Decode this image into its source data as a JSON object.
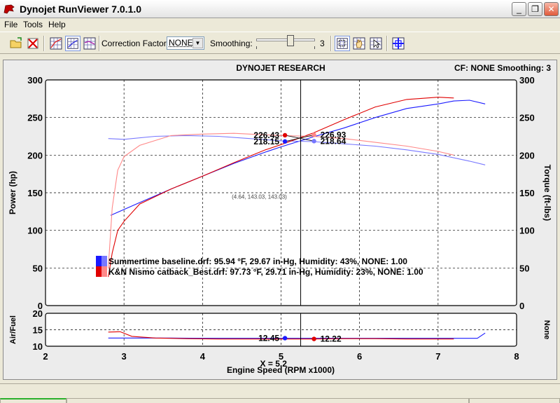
{
  "window": {
    "title": "Dynojet RunViewer 7.0.1.0",
    "minimize": "_",
    "restore": "❐",
    "close": "✕"
  },
  "menu": {
    "items": [
      "File",
      "Tools",
      "Help"
    ]
  },
  "toolbar": {
    "correction_label": "Correction Factor:",
    "correction_value": "NONE",
    "smoothing_label": "Smoothing:",
    "smoothing_value": "3"
  },
  "chart_data": {
    "type": "line",
    "title": "DYNOJET RESEARCH",
    "header_right": "CF: NONE  Smoothing: 3",
    "xlabel": "Engine Speed (RPM x1000)",
    "xlim": [
      2,
      8
    ],
    "x_ticks": [
      "2",
      "3",
      "4",
      "5",
      "6",
      "7",
      "8"
    ],
    "main": {
      "ylabel_left": "Power (hp)",
      "ylabel_right": "Torque (ft-lbs)",
      "ylim": [
        0,
        300
      ],
      "y_ticks": [
        "300",
        "250",
        "200",
        "150",
        "100",
        "50",
        "0"
      ],
      "grid": true,
      "series": [
        {
          "name": "Summertime baseline.drf",
          "kind": "power",
          "color": "#1a1aff",
          "x": [
            2.83,
            3.2,
            3.6,
            4.0,
            4.4,
            4.8,
            5.0,
            5.4,
            5.8,
            6.2,
            6.6,
            7.0,
            7.2,
            7.4,
            7.6
          ],
          "y": [
            120,
            137,
            155,
            172,
            189,
            204,
            211,
            224,
            236,
            250,
            262,
            268,
            272,
            273,
            268
          ]
        },
        {
          "name": "Summertime baseline.drf",
          "kind": "torque",
          "color": "#7777ff",
          "x": [
            2.8,
            3.0,
            3.4,
            3.8,
            4.2,
            4.6,
            5.0,
            5.4,
            5.8,
            6.2,
            6.6,
            7.0,
            7.4,
            7.6
          ],
          "y": [
            222,
            221,
            225,
            226,
            225,
            222,
            219,
            218,
            215,
            212,
            207,
            201,
            192,
            187
          ]
        },
        {
          "name": "K&N Nismo catback_Best.drf",
          "kind": "power",
          "color": "#e00000",
          "x": [
            2.8,
            2.85,
            2.92,
            3.0,
            3.2,
            3.6,
            4.0,
            4.4,
            4.8,
            5.0,
            5.4,
            5.8,
            6.2,
            6.6,
            7.0,
            7.2
          ],
          "y": [
            38,
            70,
            100,
            112,
            135,
            155,
            172,
            190,
            207,
            214,
            229,
            247,
            264,
            274,
            277,
            276
          ]
        },
        {
          "name": "K&N Nismo catback_Best.drf",
          "kind": "torque",
          "color": "#ff8888",
          "x": [
            2.8,
            2.85,
            2.92,
            3.0,
            3.2,
            3.6,
            4.0,
            4.4,
            4.8,
            5.0,
            5.4,
            5.8,
            6.2,
            6.6,
            7.0,
            7.2
          ],
          "y": [
            50,
            130,
            180,
            198,
            213,
            226,
            228,
            229,
            227,
            226,
            225,
            222,
            217,
            212,
            205,
            200
          ]
        }
      ],
      "markers": [
        {
          "x": 5.05,
          "y": 226.43,
          "label": "226.43",
          "color": "#e00000",
          "side": "left"
        },
        {
          "x": 5.05,
          "y": 218.15,
          "label": "218.15",
          "color": "#1a1aff",
          "side": "left"
        },
        {
          "x": 5.42,
          "y": 226.93,
          "label": "226.93",
          "color": "#ff8888",
          "side": "right"
        },
        {
          "x": 5.42,
          "y": 218.64,
          "label": "218.64",
          "color": "#7777ff",
          "side": "right"
        }
      ],
      "cursor_x": 5.25,
      "annotation": "(4.64, 143.03, 143.03)",
      "legend": [
        {
          "text": "Summertime baseline.drf: 95.94 °F, 29.67 in-Hg, Humidity: 43%, NONE: 1.00",
          "color": "#1a1aff"
        },
        {
          "text": "K&N Nismo catback_Best.drf: 97.73 °F, 29.71 in-Hg, Humidity: 23%, NONE: 1.00",
          "color": "#e00000"
        }
      ]
    },
    "afr": {
      "ylabel_left": "Air/Fuel",
      "ylabel_right": "None",
      "ylim": [
        10,
        20
      ],
      "y_ticks": [
        "20",
        "15",
        "10"
      ],
      "series": [
        {
          "name": "Summertime baseline.drf",
          "color": "#1a1aff",
          "x": [
            2.8,
            3.2,
            3.6,
            4.0,
            4.4,
            4.8,
            5.2,
            5.6,
            6.0,
            6.4,
            6.8,
            7.2,
            7.5,
            7.6
          ],
          "y": [
            12.5,
            12.5,
            12.5,
            12.4,
            12.4,
            12.4,
            12.4,
            12.4,
            12.4,
            12.4,
            12.4,
            12.4,
            12.4,
            14.0
          ]
        },
        {
          "name": "K&N Nismo catback_Best.drf",
          "color": "#e00000",
          "x": [
            2.8,
            2.95,
            3.1,
            3.4,
            3.8,
            4.2,
            4.6,
            5.0,
            5.4,
            5.8,
            6.2,
            6.6,
            7.0,
            7.2
          ],
          "y": [
            14.3,
            14.4,
            13.0,
            12.5,
            12.3,
            12.2,
            12.2,
            12.2,
            12.2,
            12.3,
            12.3,
            12.2,
            12.2,
            12.2
          ]
        }
      ],
      "markers": [
        {
          "x": 5.05,
          "y": 12.45,
          "label": "12.45",
          "color": "#1a1aff",
          "side": "left"
        },
        {
          "x": 5.42,
          "y": 12.22,
          "label": "12.22",
          "color": "#e00000",
          "side": "right"
        }
      ],
      "cursor_x": 5.25
    },
    "cursor_label": "X = 5.2"
  }
}
